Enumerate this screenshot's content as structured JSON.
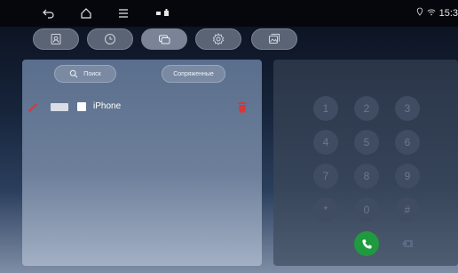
{
  "status_bar": {
    "icons": [
      "back-icon",
      "home-icon",
      "menu-icon",
      "notification-icons",
      "location-icon",
      "wifi-icon"
    ],
    "time": "15:3"
  },
  "tabs": [
    {
      "icon": "contacts-icon"
    },
    {
      "icon": "recent-calls-icon"
    },
    {
      "icon": "messages-icon",
      "active": true
    },
    {
      "icon": "settings-icon"
    },
    {
      "icon": "gallery-icon"
    }
  ],
  "device_panel": {
    "search_label": "Поиск",
    "paired_label": "Сопряженные",
    "devices": [
      {
        "name": "iPhone"
      }
    ]
  },
  "dialer": {
    "keys": [
      "1",
      "2",
      "3",
      "4",
      "5",
      "6",
      "7",
      "8",
      "9",
      "*",
      "0",
      "#"
    ]
  },
  "colors": {
    "accent_red": "#d9373a",
    "call_green": "#1f9a3e"
  }
}
